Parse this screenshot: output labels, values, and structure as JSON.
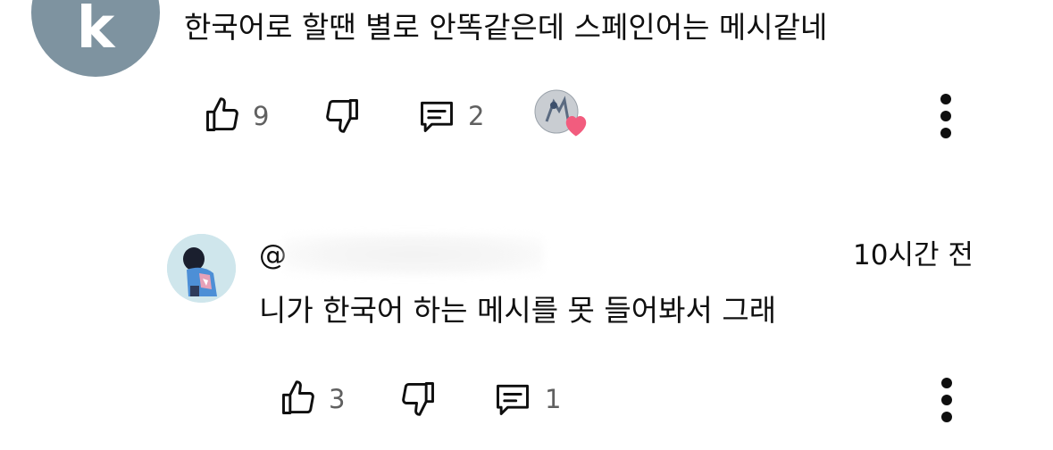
{
  "comment": {
    "avatar_letter": "k",
    "text": "한국어로 할땐 별로 안똑같은데 스페인어는 메시같네",
    "like_count": "9",
    "reply_count": "2"
  },
  "reply": {
    "handle": "@",
    "timestamp": "10시간 전",
    "text": "니가 한국어 하는 메시를 못 들어봐서 그래",
    "like_count": "3",
    "reply_count": "1"
  },
  "colors": {
    "text": "#0f0f0f",
    "meta": "#606060",
    "avatar_bg": "#7e93a0",
    "heart": "#f25c7e"
  }
}
